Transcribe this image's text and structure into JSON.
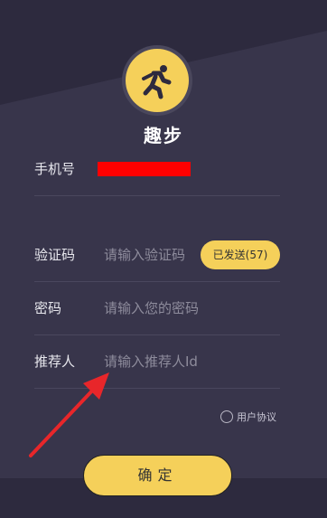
{
  "app": {
    "title": "趣步",
    "logo_icon": "running-person-icon"
  },
  "form": {
    "phone": {
      "label": "手机号",
      "value_redacted": true
    },
    "code": {
      "label": "验证码",
      "placeholder": "请输入验证码",
      "send_button": "已发送(57)"
    },
    "password": {
      "label": "密码",
      "placeholder": "请输入您的密码"
    },
    "referrer": {
      "label": "推荐人",
      "placeholder": "请输入推荐人Id"
    },
    "agreement": {
      "text": "用户协议"
    },
    "confirm_button": "确定"
  },
  "colors": {
    "accent": "#f5d05a",
    "background": "#2d2a3e",
    "panel": "#38354b",
    "annotation": "#e8262a"
  }
}
